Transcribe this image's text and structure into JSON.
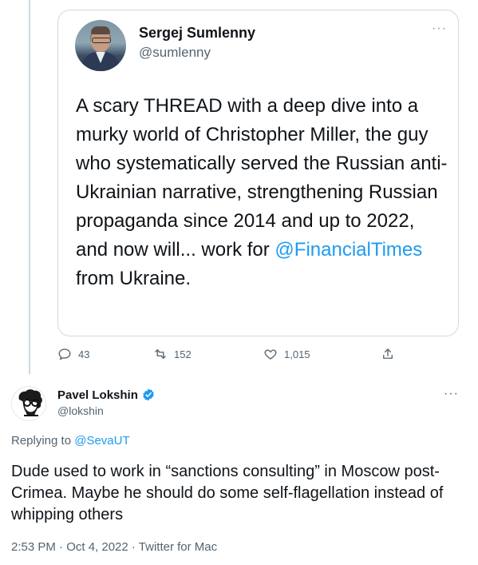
{
  "quoted_tweet": {
    "author_name": "Sergej Sumlenny",
    "author_handle": "@sumlenny",
    "more_label": "···",
    "text_before": "A scary THREAD with a deep dive into a murky world of Christopher Miller, the guy who systematically served the Russian anti-Ukrainian narrative, strengthening Russian propaganda since 2014 and up to 2022, and now will... work for ",
    "mention": "@FinancialTimes",
    "text_after": " from Ukraine.",
    "actions": {
      "replies": "43",
      "retweets": "152",
      "likes": "1,015"
    }
  },
  "main_tweet": {
    "author_name": "Pavel Lokshin",
    "author_handle": "@lokshin",
    "verified": true,
    "more_label": "···",
    "replying_prefix": "Replying to ",
    "replying_to": "@SevaUT",
    "text": "Dude used to work in “sanctions consulting” in Moscow post-Crimea. Maybe he should do some self-flagellation instead of whipping others",
    "meta": "2:53 PM · Oct 4, 2022 · Twitter for Mac"
  },
  "icons": [
    "reply-icon",
    "retweet-icon",
    "like-icon",
    "share-icon",
    "verified-badge-icon",
    "more-icon"
  ],
  "colors": {
    "accent": "#1d9bf0",
    "muted": "#536471",
    "border": "#cfd9de"
  }
}
